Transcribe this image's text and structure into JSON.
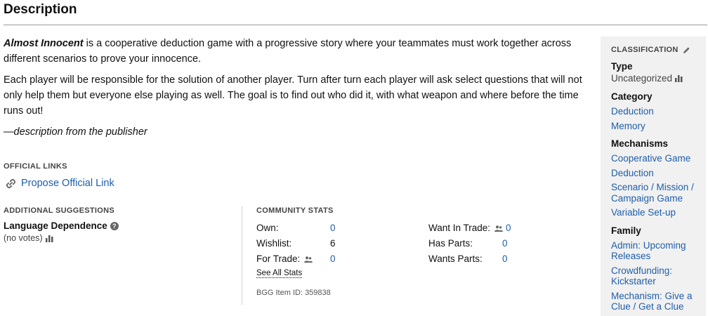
{
  "header": {
    "title": "Description"
  },
  "description": {
    "game_name": "Almost Innocent",
    "p1_rest": " is a cooperative deduction game with a progressive story where your teammates must work together across different scenarios to prove your innocence.",
    "p2": "Each player will be responsible for the solution of another player. Turn after turn each player will ask select questions that will not only help them but everyone else playing as well. The goal is to find out who did it, with what weapon and where before the time runs out!",
    "attribution": "—description from the publisher"
  },
  "official_links": {
    "label": "OFFICIAL LINKS",
    "propose": "Propose Official Link"
  },
  "suggestions": {
    "label": "ADDITIONAL SUGGESTIONS",
    "language_dependence": "Language Dependence",
    "votes": "(no votes)"
  },
  "community_stats": {
    "label": "COMMUNITY STATS",
    "left": [
      {
        "label": "Own:",
        "value": "0",
        "link": true
      },
      {
        "label": "Wishlist:",
        "value": "6",
        "link": false
      },
      {
        "label": "For Trade:",
        "value": "0",
        "link": true
      }
    ],
    "right": [
      {
        "label": "Want In Trade:",
        "value": "0",
        "link": true
      },
      {
        "label": "Has Parts:",
        "value": "0",
        "link": true
      },
      {
        "label": "Wants Parts:",
        "value": "0",
        "link": true
      }
    ],
    "see_all": "See All Stats",
    "item_id": "BGG Item ID: 359838"
  },
  "classification": {
    "label": "CLASSIFICATION",
    "type_heading": "Type",
    "type_value": "Uncategorized",
    "category_heading": "Category",
    "categories": [
      "Deduction",
      "Memory"
    ],
    "mechanisms_heading": "Mechanisms",
    "mechanisms": [
      "Cooperative Game",
      "Deduction",
      "Scenario / Mission / Campaign Game",
      "Variable Set-up"
    ],
    "family_heading": "Family",
    "families": [
      "Admin: Upcoming Releases",
      "Crowdfunding: Kickstarter",
      "Mechanism: Give a Clue / Get a Clue"
    ]
  },
  "colors": {
    "link": "#1f5eaa",
    "panel_bg": "#f1f1f1",
    "text": "#111111",
    "muted": "#444444"
  },
  "icons": {
    "link": "link-icon",
    "bars": "bar-chart-icon",
    "help": "question-icon",
    "edit": "pencil-icon",
    "people": "people-icon"
  }
}
